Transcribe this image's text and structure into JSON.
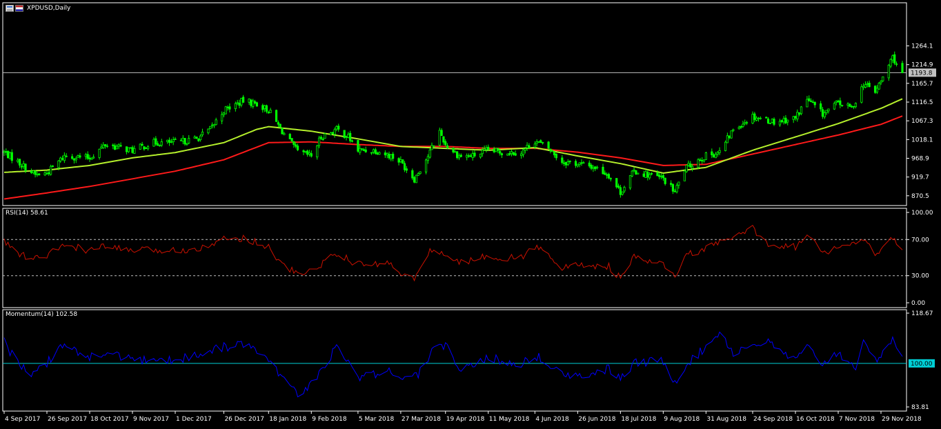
{
  "header": {
    "symbol_label": "XPDUSD,Daily"
  },
  "colors": {
    "background": "#000000",
    "bull_candle": "#00ff00",
    "bear_candle": "#00ff00",
    "ma_fast": "#b5f02c",
    "ma_slow": "#ff1a1a",
    "rsi_line": "#cc1100",
    "momentum_line": "#0000ff",
    "momentum_level": "#00cfd6",
    "price_line": "#c0c0c0",
    "axis": "#ffffff"
  },
  "icons": [
    "chart-window-icon",
    "us-flag-icon"
  ],
  "chart_data": [
    {
      "type": "candlestick",
      "title": "XPDUSD,Daily",
      "y_ticks": [
        "1264.1",
        "1214.9",
        "1165.7",
        "1116.5",
        "1067.3",
        "1018.1",
        "968.9",
        "919.7",
        "870.5"
      ],
      "ylim": [
        843,
        1280
      ],
      "current_price": "1193.8",
      "current_price_value": 1193.8,
      "x_ticks": [
        "4 Sep 2017",
        "26 Sep 2017",
        "18 Oct 2017",
        "9 Nov 2017",
        "1 Dec 2017",
        "26 Dec 2017",
        "18 Jan 2018",
        "9 Feb 2018",
        "5 Mar 2018",
        "27 Mar 2018",
        "19 Apr 2018",
        "11 May 2018",
        "4 Jun 2018",
        "26 Jun 2018",
        "18 Jul 2018",
        "9 Aug 2018",
        "31 Aug 2018",
        "24 Sep 2018",
        "16 Oct 2018",
        "7 Nov 2018",
        "29 Nov 2018"
      ],
      "close_keypoints": [
        [
          "4 Sep 2017",
          985
        ],
        [
          "11 Sep 2017",
          960
        ],
        [
          "20 Sep 2017",
          925
        ],
        [
          "26 Sep 2017",
          930
        ],
        [
          "5 Oct 2017",
          975
        ],
        [
          "18 Oct 2017",
          970
        ],
        [
          "26 Oct 2017",
          1005
        ],
        [
          "9 Nov 2017",
          990
        ],
        [
          "20 Nov 2017",
          1010
        ],
        [
          "1 Dec 2017",
          1010
        ],
        [
          "12 Dec 2017",
          1020
        ],
        [
          "19 Dec 2017",
          1045
        ],
        [
          "26 Dec 2017",
          1095
        ],
        [
          "5 Jan 2018",
          1120
        ],
        [
          "12 Jan 2018",
          1112
        ],
        [
          "18 Jan 2018",
          1095
        ],
        [
          "25 Jan 2018",
          1040
        ],
        [
          "2 Feb 2018",
          985
        ],
        [
          "9 Feb 2018",
          975
        ],
        [
          "14 Feb 2018",
          1025
        ],
        [
          "22 Feb 2018",
          1045
        ],
        [
          "28 Feb 2018",
          1025
        ],
        [
          "5 Mar 2018",
          990
        ],
        [
          "14 Mar 2018",
          990
        ],
        [
          "22 Mar 2018",
          975
        ],
        [
          "27 Mar 2018",
          960
        ],
        [
          "3 Apr 2018",
          915
        ],
        [
          "10 Apr 2018",
          975
        ],
        [
          "16 Apr 2018",
          1040
        ],
        [
          "19 Apr 2018",
          1005
        ],
        [
          "26 Apr 2018",
          975
        ],
        [
          "3 May 2018",
          975
        ],
        [
          "11 May 2018",
          990
        ],
        [
          "18 May 2018",
          985
        ],
        [
          "28 May 2018",
          985
        ],
        [
          "4 Jun 2018",
          1015
        ],
        [
          "11 Jun 2018",
          995
        ],
        [
          "18 Jun 2018",
          960
        ],
        [
          "26 Jun 2018",
          955
        ],
        [
          "5 Jul 2018",
          945
        ],
        [
          "12 Jul 2018",
          925
        ],
        [
          "18 Jul 2018",
          880
        ],
        [
          "25 Jul 2018",
          935
        ],
        [
          "2 Aug 2018",
          925
        ],
        [
          "9 Aug 2018",
          915
        ],
        [
          "15 Aug 2018",
          880
        ],
        [
          "20 Aug 2018",
          940
        ],
        [
          "27 Aug 2018",
          965
        ],
        [
          "31 Aug 2018",
          975
        ],
        [
          "7 Sep 2018",
          985
        ],
        [
          "14 Sep 2018",
          1045
        ],
        [
          "24 Sep 2018",
          1080
        ],
        [
          "5 Oct 2018",
          1065
        ],
        [
          "16 Oct 2018",
          1075
        ],
        [
          "22 Oct 2018",
          1125
        ],
        [
          "30 Oct 2018",
          1085
        ],
        [
          "7 Nov 2018",
          1115
        ],
        [
          "14 Nov 2018",
          1100
        ],
        [
          "20 Nov 2018",
          1165
        ],
        [
          "26 Nov 2018",
          1145
        ],
        [
          "29 Nov 2018",
          1170
        ],
        [
          "5 Dec 2018",
          1235
        ],
        [
          "10 Dec 2018",
          1193.8
        ]
      ],
      "ma_fast_keypoints": [
        [
          "4 Sep 2017",
          932
        ],
        [
          "26 Sep 2017",
          938
        ],
        [
          "18 Oct 2017",
          950
        ],
        [
          "9 Nov 2017",
          970
        ],
        [
          "1 Dec 2017",
          984
        ],
        [
          "26 Dec 2017",
          1010
        ],
        [
          "12 Jan 2018",
          1045
        ],
        [
          "18 Jan 2018",
          1052
        ],
        [
          "9 Feb 2018",
          1040
        ],
        [
          "5 Mar 2018",
          1020
        ],
        [
          "27 Mar 2018",
          1000
        ],
        [
          "19 Apr 2018",
          995
        ],
        [
          "11 May 2018",
          990
        ],
        [
          "4 Jun 2018",
          997
        ],
        [
          "26 Jun 2018",
          975
        ],
        [
          "18 Jul 2018",
          955
        ],
        [
          "9 Aug 2018",
          930
        ],
        [
          "31 Aug 2018",
          945
        ],
        [
          "24 Sep 2018",
          990
        ],
        [
          "16 Oct 2018",
          1025
        ],
        [
          "7 Nov 2018",
          1060
        ],
        [
          "29 Nov 2018",
          1100
        ],
        [
          "10 Dec 2018",
          1125
        ]
      ],
      "ma_slow_keypoints": [
        [
          "4 Sep 2017",
          862
        ],
        [
          "26 Sep 2017",
          878
        ],
        [
          "18 Oct 2017",
          895
        ],
        [
          "9 Nov 2017",
          915
        ],
        [
          "1 Dec 2017",
          935
        ],
        [
          "26 Dec 2017",
          965
        ],
        [
          "18 Jan 2018",
          1010
        ],
        [
          "9 Feb 2018",
          1012
        ],
        [
          "5 Mar 2018",
          1005
        ],
        [
          "27 Mar 2018",
          1000
        ],
        [
          "19 Apr 2018",
          1000
        ],
        [
          "11 May 2018",
          995
        ],
        [
          "4 Jun 2018",
          995
        ],
        [
          "26 Jun 2018",
          985
        ],
        [
          "18 Jul 2018",
          970
        ],
        [
          "9 Aug 2018",
          950
        ],
        [
          "31 Aug 2018",
          953
        ],
        [
          "24 Sep 2018",
          980
        ],
        [
          "16 Oct 2018",
          1005
        ],
        [
          "7 Nov 2018",
          1030
        ],
        [
          "29 Nov 2018",
          1058
        ],
        [
          "10 Dec 2018",
          1080
        ]
      ]
    },
    {
      "type": "line",
      "title": "RSI(14) 58.61",
      "y_ticks": [
        "100.00",
        "70.00",
        "30.00",
        "0.00"
      ],
      "levels": [
        70,
        30
      ],
      "ylim": [
        0,
        100
      ],
      "keypoints": [
        [
          "4 Sep 2017",
          68
        ],
        [
          "11 Sep 2017",
          55
        ],
        [
          "18 Sep 2017",
          48
        ],
        [
          "26 Sep 2017",
          52
        ],
        [
          "5 Oct 2017",
          64
        ],
        [
          "18 Oct 2017",
          58
        ],
        [
          "26 Oct 2017",
          62
        ],
        [
          "9 Nov 2017",
          58
        ],
        [
          "1 Dec 2017",
          58
        ],
        [
          "12 Dec 2017",
          60
        ],
        [
          "26 Dec 2017",
          70
        ],
        [
          "5 Jan 2018",
          72
        ],
        [
          "18 Jan 2018",
          62
        ],
        [
          "25 Jan 2018",
          42
        ],
        [
          "2 Feb 2018",
          32
        ],
        [
          "9 Feb 2018",
          35
        ],
        [
          "22 Feb 2018",
          55
        ],
        [
          "5 Mar 2018",
          42
        ],
        [
          "22 Mar 2018",
          44
        ],
        [
          "29 Mar 2018",
          30
        ],
        [
          "3 Apr 2018",
          26
        ],
        [
          "12 Apr 2018",
          60
        ],
        [
          "19 Apr 2018",
          52
        ],
        [
          "26 Apr 2018",
          44
        ],
        [
          "11 May 2018",
          52
        ],
        [
          "18 May 2018",
          50
        ],
        [
          "28 May 2018",
          50
        ],
        [
          "4 Jun 2018",
          62
        ],
        [
          "11 Jun 2018",
          55
        ],
        [
          "18 Jun 2018",
          38
        ],
        [
          "26 Jun 2018",
          42
        ],
        [
          "12 Jul 2018",
          40
        ],
        [
          "18 Jul 2018",
          27
        ],
        [
          "25 Jul 2018",
          50
        ],
        [
          "9 Aug 2018",
          42
        ],
        [
          "15 Aug 2018",
          28
        ],
        [
          "20 Aug 2018",
          52
        ],
        [
          "31 Aug 2018",
          60
        ],
        [
          "14 Sep 2018",
          72
        ],
        [
          "24 Sep 2018",
          82
        ],
        [
          "1 Oct 2018",
          66
        ],
        [
          "16 Oct 2018",
          62
        ],
        [
          "22 Oct 2018",
          75
        ],
        [
          "30 Oct 2018",
          55
        ],
        [
          "7 Nov 2018",
          62
        ],
        [
          "20 Nov 2018",
          68
        ],
        [
          "26 Nov 2018",
          55
        ],
        [
          "5 Dec 2018",
          70
        ],
        [
          "10 Dec 2018",
          58.61
        ]
      ]
    },
    {
      "type": "line",
      "title": "Momentum(14) 102.58",
      "y_ticks": [
        "118.67",
        "100.00",
        "83.81"
      ],
      "level": 100,
      "level_label": "100.00",
      "ylim": [
        83.81,
        118.67
      ],
      "keypoints": [
        [
          "4 Sep 2017",
          108
        ],
        [
          "11 Sep 2017",
          100
        ],
        [
          "18 Sep 2017",
          95
        ],
        [
          "26 Sep 2017",
          100
        ],
        [
          "5 Oct 2017",
          107
        ],
        [
          "18 Oct 2017",
          102
        ],
        [
          "26 Oct 2017",
          104
        ],
        [
          "9 Nov 2017",
          101
        ],
        [
          "1 Dec 2017",
          101
        ],
        [
          "12 Dec 2017",
          103
        ],
        [
          "26 Dec 2017",
          106
        ],
        [
          "5 Jan 2018",
          107
        ],
        [
          "18 Jan 2018",
          101
        ],
        [
          "25 Jan 2018",
          94
        ],
        [
          "2 Feb 2018",
          88
        ],
        [
          "9 Feb 2018",
          92
        ],
        [
          "22 Feb 2018",
          106
        ],
        [
          "5 Mar 2018",
          95
        ],
        [
          "22 Mar 2018",
          97
        ],
        [
          "29 Mar 2018",
          94
        ],
        [
          "5 Apr 2018",
          96
        ],
        [
          "12 Apr 2018",
          104
        ],
        [
          "19 Apr 2018",
          107
        ],
        [
          "26 Apr 2018",
          98
        ],
        [
          "11 May 2018",
          102
        ],
        [
          "18 May 2018",
          101
        ],
        [
          "28 May 2018",
          100
        ],
        [
          "4 Jun 2018",
          103
        ],
        [
          "11 Jun 2018",
          100
        ],
        [
          "18 Jun 2018",
          97
        ],
        [
          "26 Jun 2018",
          95
        ],
        [
          "12 Jul 2018",
          98
        ],
        [
          "18 Jul 2018",
          94
        ],
        [
          "25 Jul 2018",
          100
        ],
        [
          "9 Aug 2018",
          101
        ],
        [
          "15 Aug 2018",
          93
        ],
        [
          "20 Aug 2018",
          99
        ],
        [
          "31 Aug 2018",
          106
        ],
        [
          "7 Sep 2018",
          112
        ],
        [
          "14 Sep 2018",
          104
        ],
        [
          "24 Sep 2018",
          107
        ],
        [
          "1 Oct 2018",
          108
        ],
        [
          "16 Oct 2018",
          101
        ],
        [
          "22 Oct 2018",
          106
        ],
        [
          "30 Oct 2018",
          100
        ],
        [
          "7 Nov 2018",
          104
        ],
        [
          "16 Nov 2018",
          99
        ],
        [
          "20 Nov 2018",
          107
        ],
        [
          "26 Nov 2018",
          101
        ],
        [
          "5 Dec 2018",
          109
        ],
        [
          "10 Dec 2018",
          102.58
        ]
      ]
    }
  ]
}
